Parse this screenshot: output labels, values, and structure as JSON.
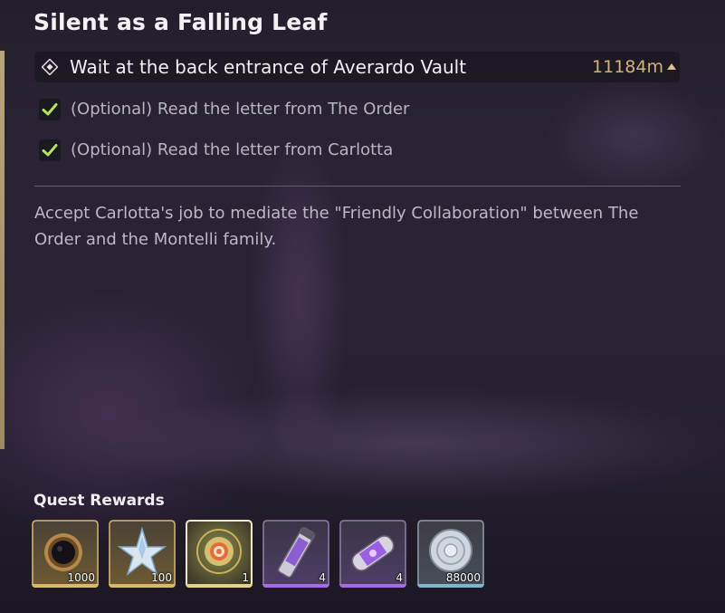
{
  "quest": {
    "title": "Silent as a Falling Leaf",
    "objective": {
      "text": "Wait at the back entrance of Averardo Vault",
      "distance": "11184m"
    },
    "optional_steps": [
      {
        "text": "(Optional) Read the letter from The Order",
        "completed": true
      },
      {
        "text": "(Optional) Read the letter from Carlotta",
        "completed": true
      }
    ],
    "description": "Accept Carlotta's job to mediate the \"Friendly Collaboration\" between The Order and the Montelli family."
  },
  "rewards": {
    "label": "Quest Rewards",
    "items": [
      {
        "icon": "dark-orb-icon",
        "quantity": "1000",
        "rarity_color": "#d8b96a"
      },
      {
        "icon": "crystal-star-icon",
        "quantity": "100",
        "rarity_color": "#d8b96a"
      },
      {
        "icon": "golden-compass-icon",
        "quantity": "1",
        "rarity_color": "#e6cf86"
      },
      {
        "icon": "purple-canister-icon",
        "quantity": "4",
        "rarity_color": "#a66be0"
      },
      {
        "icon": "purple-capsule-icon",
        "quantity": "4",
        "rarity_color": "#a66be0"
      },
      {
        "icon": "shell-coin-icon",
        "quantity": "88000",
        "rarity_color": "#7fb6cf"
      }
    ]
  },
  "colors": {
    "accent_gold": "#cdb57a",
    "check_green": "#b4e25a"
  }
}
